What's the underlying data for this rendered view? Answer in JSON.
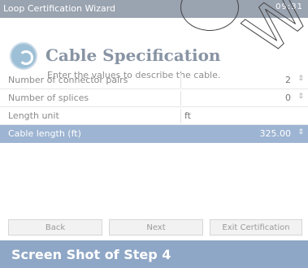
{
  "window": {
    "title": "Loop Certification Wizard",
    "status": "09:31"
  },
  "header": {
    "icon": "cable-icon",
    "title": "Cable Specification",
    "subtitle": "Enter the values to describe the cable."
  },
  "form": {
    "rows": [
      {
        "label": "Number of connector pairs",
        "value": "2"
      },
      {
        "label": "Number of splices",
        "value": "0"
      },
      {
        "label": "Length unit",
        "value": "ft"
      },
      {
        "label": "Cable length (ft)",
        "value": "325.00"
      }
    ]
  },
  "buttons": {
    "back": "Back",
    "next": "Next",
    "exit": "Exit Certification"
  },
  "caption": "Screen Shot of Step 4",
  "watermark": {
    "letter": "W"
  },
  "colors": {
    "titlebar": "#9aa3b0",
    "highlight_row": "#9db4d2",
    "caption_bar": "#8fa7c6"
  }
}
